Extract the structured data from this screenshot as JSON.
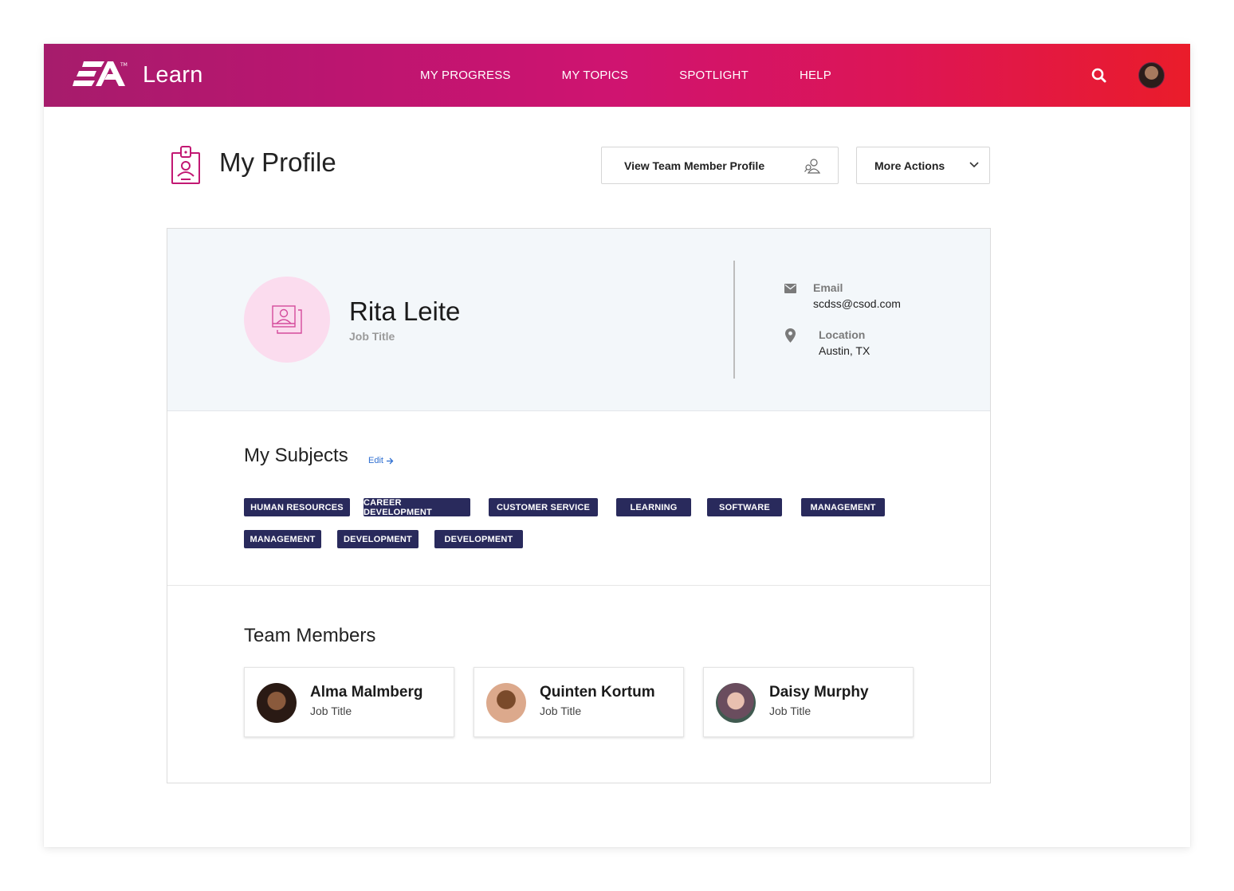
{
  "header": {
    "brand_logo": "EA",
    "brand_name": "Learn",
    "nav": [
      "MY PROGRESS",
      "MY TOPICS",
      "SPOTLIGHT",
      "HELP"
    ],
    "search_icon": "search-icon",
    "accent_start": "#a61c6c",
    "accent_end": "#ea1c2a"
  },
  "page": {
    "title": "My Profile",
    "title_icon": "id-badge-icon",
    "view_team_button": "View Team Member Profile",
    "more_actions_button": "More Actions"
  },
  "profile": {
    "name": "Rita Leite",
    "job_title": "Job Title",
    "email_label": "Email",
    "email": "scdss@csod.com",
    "location_label": "Location",
    "location": "Austin, TX"
  },
  "subjects": {
    "title": "My Subjects",
    "edit_label": "Edit",
    "tag_color": "#292a5c",
    "tags": [
      "HUMAN RESOURCES",
      "CAREER DEVELOPMENT",
      "CUSTOMER SERVICE",
      "LEARNING",
      "SOFTWARE",
      "MANAGEMENT",
      "MANAGEMENT",
      "DEVELOPMENT",
      "DEVELOPMENT"
    ]
  },
  "team": {
    "title": "Team Members",
    "members": [
      {
        "name": "Alma Malmberg",
        "job_title": "Job Title"
      },
      {
        "name": "Quinten Kortum",
        "job_title": "Job Title"
      },
      {
        "name": "Daisy Murphy",
        "job_title": "Job Title"
      }
    ]
  }
}
